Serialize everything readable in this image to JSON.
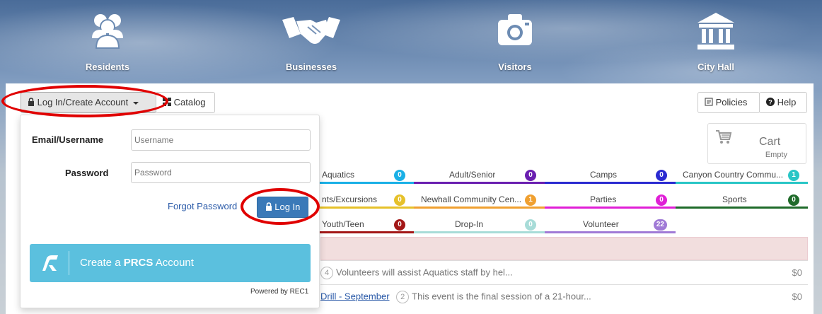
{
  "nav": {
    "items": [
      {
        "label": "Residents",
        "icon": "people-icon"
      },
      {
        "label": "Businesses",
        "icon": "handshake-icon"
      },
      {
        "label": "Visitors",
        "icon": "camera-icon"
      },
      {
        "label": "City Hall",
        "icon": "building-icon"
      }
    ]
  },
  "toolbar": {
    "login_toggle_label": "Log In/Create Account",
    "catalog_label": "Catalog",
    "policies_label": "Policies",
    "help_label": "Help"
  },
  "cart": {
    "label": "Cart",
    "status": "Empty"
  },
  "categories": [
    {
      "label": "Aquatics",
      "count": "0",
      "color": "#1ab0e6"
    },
    {
      "label": "Adult/Senior",
      "count": "0",
      "color": "#6a1fb0"
    },
    {
      "label": "Camps",
      "count": "0",
      "color": "#2b2bd1"
    },
    {
      "label": "Canyon Country Commu...",
      "count": "1",
      "color": "#29c6c6"
    },
    {
      "label": "nts/Excursions",
      "count": "0",
      "color": "#e6c12a"
    },
    {
      "label": "Newhall Community Cen...",
      "count": "1",
      "color": "#f0a030"
    },
    {
      "label": "Parties",
      "count": "0",
      "color": "#e01fd6"
    },
    {
      "label": "Sports",
      "count": "0",
      "color": "#1f6b2a"
    },
    {
      "label": "Youth/Teen",
      "count": "0",
      "color": "#a31717"
    },
    {
      "label": "Drop-In",
      "count": "0",
      "color": "#a8dcd8"
    },
    {
      "label": "Volunteer",
      "count": "22",
      "color": "#a07ad6"
    }
  ],
  "rows": [
    {
      "number": "4",
      "link": "",
      "text": "Volunteers will assist Aquatics staff by hel...",
      "price": "$0"
    },
    {
      "number": "2",
      "link": "Drill - September",
      "text": "This event is the final session of a 21-hour...",
      "price": "$0"
    }
  ],
  "login": {
    "email_label": "Email/Username",
    "email_placeholder": "Username",
    "password_label": "Password",
    "password_placeholder": "Password",
    "forgot_label": "Forgot Password",
    "login_button": "Log In",
    "create_prefix": "Create a ",
    "create_brand": "PRCS",
    "create_suffix": " Account",
    "powered_by": "Powered by REC1"
  },
  "colors": {
    "primary": "#3a79b8",
    "create": "#5bc0de",
    "highlight": "#e00000"
  }
}
